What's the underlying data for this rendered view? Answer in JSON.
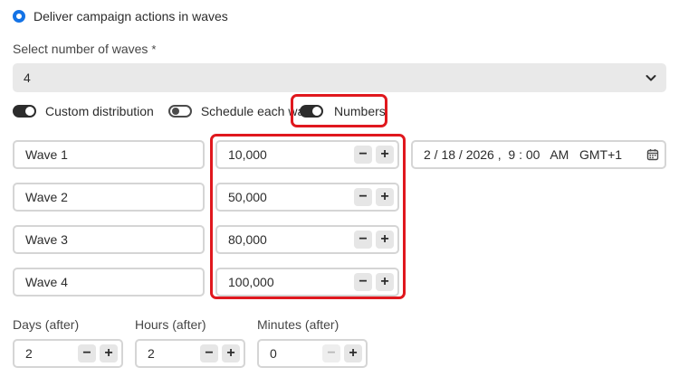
{
  "delivery": {
    "radio_label": "Deliver campaign actions in waves"
  },
  "waves_select": {
    "label": "Select number of waves",
    "required_mark": "*",
    "value": "4"
  },
  "toggles": [
    {
      "label": "Custom distribution",
      "state": "on"
    },
    {
      "label": "Schedule each wave",
      "state": "off"
    },
    {
      "label": "Numbers",
      "state": "on"
    }
  ],
  "waves": [
    {
      "name": "Wave 1",
      "amount": "10,000"
    },
    {
      "name": "Wave 2",
      "amount": "50,000"
    },
    {
      "name": "Wave 3",
      "amount": "80,000"
    },
    {
      "name": "Wave 4",
      "amount": "100,000"
    }
  ],
  "schedule_date": "2 / 18 / 2026 ,  9 : 00   AM   GMT+1",
  "stepper_symbols": {
    "minus": "−",
    "plus": "+"
  },
  "intervals": [
    {
      "label": "Days (after)",
      "value": "2"
    },
    {
      "label": "Hours (after)",
      "value": "2"
    },
    {
      "label": "Minutes (after)",
      "value": "0"
    }
  ],
  "colors": {
    "accent": "#1473e6",
    "highlight": "#e0181e"
  }
}
